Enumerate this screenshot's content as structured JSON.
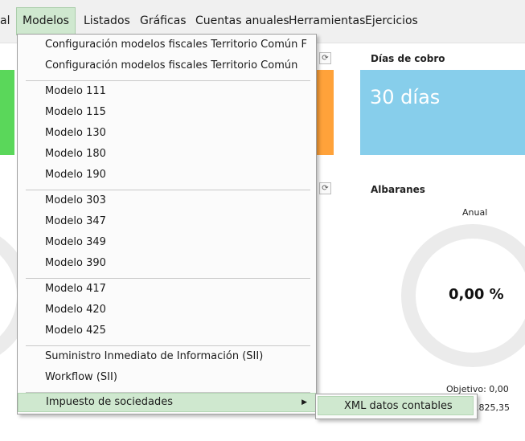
{
  "menubar": {
    "items": [
      {
        "label": "al"
      },
      {
        "label": "Modelos",
        "active": true
      },
      {
        "label": "Listados"
      },
      {
        "label": "Gráficas"
      },
      {
        "label": "Cuentas anuales"
      },
      {
        "label": "Herramientas"
      },
      {
        "label": "Ejercicios"
      }
    ]
  },
  "widgets": {
    "dias_cobro": {
      "title": "Días de cobro",
      "value": "30 días"
    },
    "albaranes": {
      "title": "Albaranes",
      "period": "Anual",
      "percent": "0,00 %",
      "objetivo": "Objetivo: 0,00",
      "amount": ".825,35"
    }
  },
  "icons": {
    "refresh": "refresh-icon",
    "submenu_arrow": "chevron-right-icon"
  },
  "colors": {
    "accent": "#cfe8cf",
    "tile_blue": "#87ceeb",
    "tile_green": "#5ad75a",
    "tile_orange": "#ffa23a"
  },
  "dropdown": {
    "items": [
      "Configuración modelos fiscales Territorio Común F",
      "Configuración modelos fiscales Territorio Común",
      "Modelo 111",
      "Modelo 115",
      "Modelo 130",
      "Modelo 180",
      "Modelo 190",
      "Modelo 303",
      "Modelo 347",
      "Modelo 349",
      "Modelo 390",
      "Modelo 417",
      "Modelo 420",
      "Modelo 425",
      "Suministro Inmediato de Información (SII)",
      "Workflow (SII)",
      "Impuesto de sociedades"
    ]
  },
  "submenu": {
    "items": [
      "XML datos contables"
    ]
  }
}
